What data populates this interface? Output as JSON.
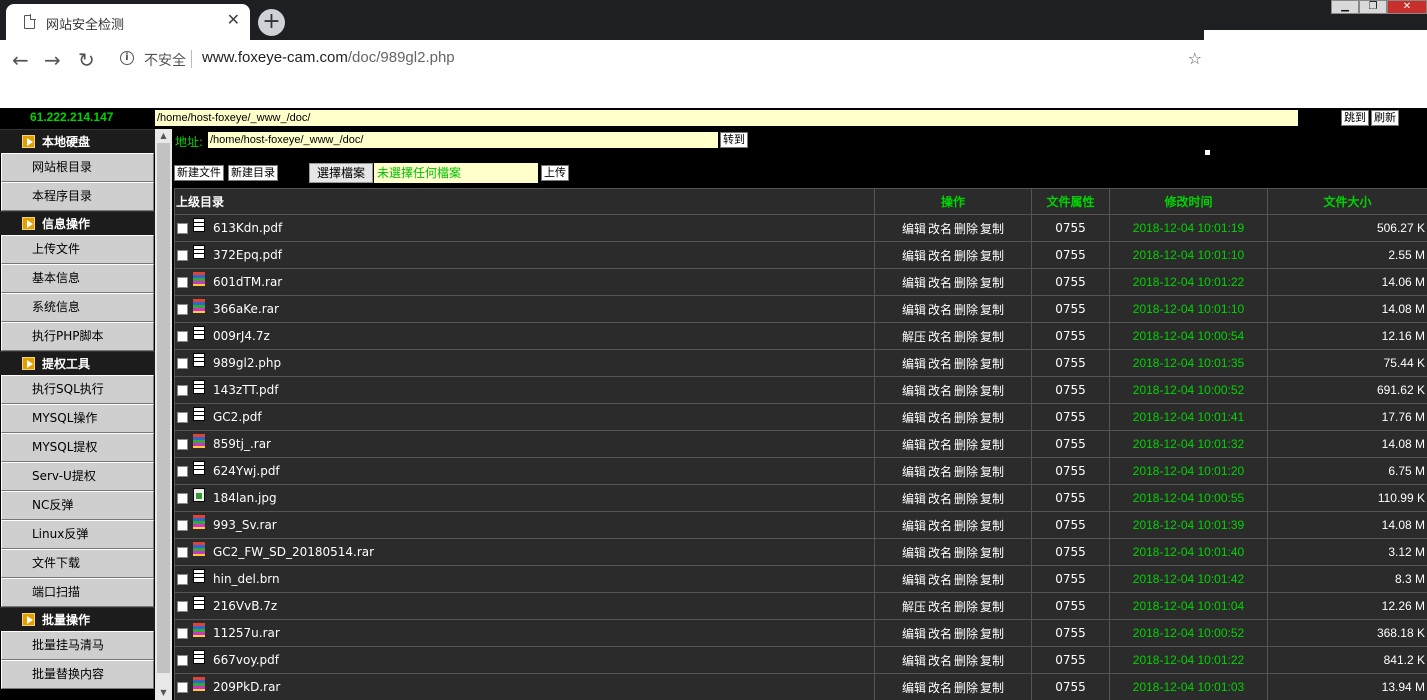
{
  "browser": {
    "tab_title": "网站安全检测",
    "tab_close": "✕",
    "new_tab": "+",
    "security": "不安全",
    "url_host": "www.foxeye-cam.com",
    "url_path": "/doc/989gl2.php",
    "window_controls": [
      "▁",
      "❐",
      "✕"
    ]
  },
  "topbar": {
    "ip": "61.222.214.147",
    "path": "/home/host-foxeye/_www_/doc/",
    "jump_button": "跳到",
    "refresh_button": "刷新"
  },
  "sidebar": {
    "sections": [
      {
        "title": "本地硬盘",
        "items": [
          "网站根目录",
          "本程序目录"
        ]
      },
      {
        "title": "信息操作",
        "items": [
          "上传文件",
          "基本信息",
          "系统信息",
          "执行PHP脚本"
        ]
      },
      {
        "title": "提权工具",
        "items": [
          "执行SQL执行",
          "MYSQL操作",
          "MYSQL提权",
          "Serv-U提权",
          "NC反弹",
          "Linux反弹",
          "文件下载",
          "端口扫描"
        ]
      },
      {
        "title": "批量操作",
        "items": [
          "批量挂马清马",
          "批量替换内容"
        ]
      }
    ]
  },
  "main": {
    "address_label": "地址:",
    "address_value": "/home/host-foxeye/_www_/doc/",
    "goto_button": "转到",
    "new_file_button": "新建文件",
    "new_dir_button": "新建目录",
    "choose_file_button": "選擇檔案",
    "no_file_text": "未選擇任何檔案",
    "upload_button": "上传"
  },
  "table": {
    "headers": {
      "up": "上级目录",
      "ops": "操作",
      "perm": "文件属性",
      "mtime": "修改时间",
      "size": "文件大小"
    },
    "rows": [
      {
        "name": "613Kdn.pdf",
        "icon": "doc-icon",
        "ops": [
          "编辑",
          "改名",
          "删除",
          "复制"
        ],
        "perm": "0755",
        "mtime": "2018-12-04 10:01:19",
        "size": "506.27 K"
      },
      {
        "name": "372Epq.pdf",
        "icon": "doc-icon",
        "ops": [
          "编辑",
          "改名",
          "删除",
          "复制"
        ],
        "perm": "0755",
        "mtime": "2018-12-04 10:01:10",
        "size": "2.55 M"
      },
      {
        "name": "601dTM.rar",
        "icon": "rar-icon",
        "ops": [
          "编辑",
          "改名",
          "删除",
          "复制"
        ],
        "perm": "0755",
        "mtime": "2018-12-04 10:01:22",
        "size": "14.06 M"
      },
      {
        "name": "366aKe.rar",
        "icon": "rar-icon",
        "ops": [
          "编辑",
          "改名",
          "删除",
          "复制"
        ],
        "perm": "0755",
        "mtime": "2018-12-04 10:01:10",
        "size": "14.08 M"
      },
      {
        "name": "009rJ4.7z",
        "icon": "doc-icon",
        "ops": [
          "解压",
          "改名",
          "删除",
          "复制"
        ],
        "perm": "0755",
        "mtime": "2018-12-04 10:00:54",
        "size": "12.16 M"
      },
      {
        "name": "989gl2.php",
        "icon": "doc-icon",
        "ops": [
          "编辑",
          "改名",
          "删除",
          "复制"
        ],
        "perm": "0755",
        "mtime": "2018-12-04 10:01:35",
        "size": "75.44 K"
      },
      {
        "name": "143zTT.pdf",
        "icon": "doc-icon",
        "ops": [
          "编辑",
          "改名",
          "删除",
          "复制"
        ],
        "perm": "0755",
        "mtime": "2018-12-04 10:00:52",
        "size": "691.62 K"
      },
      {
        "name": "GC2.pdf",
        "icon": "doc-icon",
        "ops": [
          "编辑",
          "改名",
          "删除",
          "复制"
        ],
        "perm": "0755",
        "mtime": "2018-12-04 10:01:41",
        "size": "17.76 M"
      },
      {
        "name": "859tj_.rar",
        "icon": "rar-icon",
        "ops": [
          "编辑",
          "改名",
          "删除",
          "复制"
        ],
        "perm": "0755",
        "mtime": "2018-12-04 10:01:32",
        "size": "14.08 M"
      },
      {
        "name": "624Ywj.pdf",
        "icon": "doc-icon",
        "ops": [
          "编辑",
          "改名",
          "删除",
          "复制"
        ],
        "perm": "0755",
        "mtime": "2018-12-04 10:01:20",
        "size": "6.75 M"
      },
      {
        "name": "184lan.jpg",
        "icon": "jpg-icon",
        "ops": [
          "编辑",
          "改名",
          "删除",
          "复制"
        ],
        "perm": "0755",
        "mtime": "2018-12-04 10:00:55",
        "size": "110.99 K"
      },
      {
        "name": "993_Sv.rar",
        "icon": "rar-icon",
        "ops": [
          "编辑",
          "改名",
          "删除",
          "复制"
        ],
        "perm": "0755",
        "mtime": "2018-12-04 10:01:39",
        "size": "14.08 M"
      },
      {
        "name": "GC2_FW_SD_20180514.rar",
        "icon": "rar-icon",
        "ops": [
          "编辑",
          "改名",
          "删除",
          "复制"
        ],
        "perm": "0755",
        "mtime": "2018-12-04 10:01:40",
        "size": "3.12 M"
      },
      {
        "name": "hin_del.brn",
        "icon": "doc-icon",
        "ops": [
          "编辑",
          "改名",
          "删除",
          "复制"
        ],
        "perm": "0755",
        "mtime": "2018-12-04 10:01:42",
        "size": "8.3 M"
      },
      {
        "name": "216VvB.7z",
        "icon": "doc-icon",
        "ops": [
          "解压",
          "改名",
          "删除",
          "复制"
        ],
        "perm": "0755",
        "mtime": "2018-12-04 10:01:04",
        "size": "12.26 M"
      },
      {
        "name": "11257u.rar",
        "icon": "rar-icon",
        "ops": [
          "编辑",
          "改名",
          "删除",
          "复制"
        ],
        "perm": "0755",
        "mtime": "2018-12-04 10:00:52",
        "size": "368.18 K"
      },
      {
        "name": "667voy.pdf",
        "icon": "doc-icon",
        "ops": [
          "编辑",
          "改名",
          "删除",
          "复制"
        ],
        "perm": "0755",
        "mtime": "2018-12-04 10:01:22",
        "size": "841.2 K"
      },
      {
        "name": "209PkD.rar",
        "icon": "rar-icon",
        "ops": [
          "编辑",
          "改名",
          "删除",
          "复制"
        ],
        "perm": "0755",
        "mtime": "2018-12-04 10:01:03",
        "size": "13.94 M"
      }
    ]
  }
}
